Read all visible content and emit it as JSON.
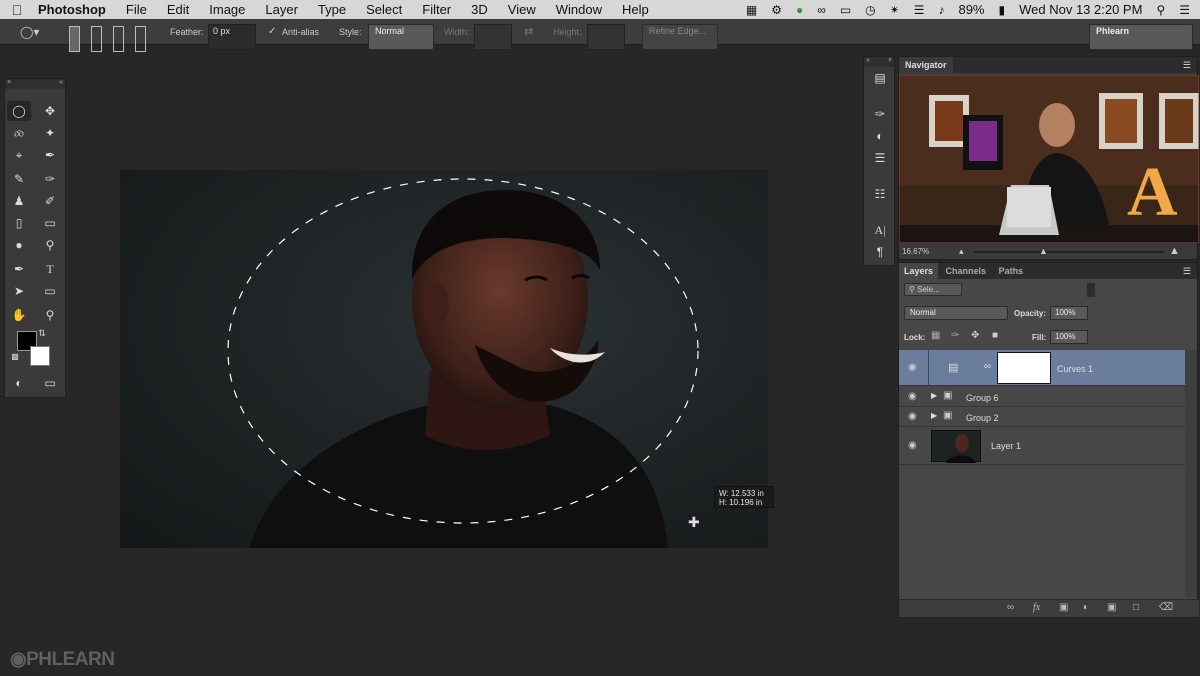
{
  "menubar": {
    "apple": "",
    "items": [
      "Photoshop",
      "File",
      "Edit",
      "Image",
      "Layer",
      "Type",
      "Select",
      "Filter",
      "3D",
      "View",
      "Window",
      "Help"
    ],
    "battery": "89%",
    "datetime": "Wed Nov 13  2:20 PM"
  },
  "options": {
    "feather_label": "Feather:",
    "feather_value": "0 px",
    "antialias_label": "Anti-alias",
    "style_label": "Style:",
    "style_value": "Normal",
    "width_label": "Width:",
    "height_label": "Height:",
    "refine_edge": "Refine Edge...",
    "workspace": "Phlearn"
  },
  "canvas": {
    "readout_w": "W: 12.533 in",
    "readout_h": "H: 10.196 in"
  },
  "navigator": {
    "title": "Navigator",
    "zoom": "16.67%"
  },
  "layers_panel": {
    "tabs": [
      "Layers",
      "Channels",
      "Paths"
    ],
    "filter_placeholder": "Sele...",
    "blend_mode": "Normal",
    "opacity_label": "Opacity:",
    "opacity_value": "100%",
    "lock_label": "Lock:",
    "fill_label": "Fill:",
    "fill_value": "100%",
    "layers": [
      {
        "name": "Curves 1",
        "type": "adjustment",
        "selected": true
      },
      {
        "name": "Group 6",
        "type": "group"
      },
      {
        "name": "Group 2",
        "type": "group"
      },
      {
        "name": "Layer 1",
        "type": "pixel"
      }
    ],
    "footer_fx": "fx"
  },
  "watermark": "PHLEARN",
  "colors": {
    "foreground": "#000000",
    "background": "#ffffff",
    "selected_layer": "#6a7d9c"
  }
}
